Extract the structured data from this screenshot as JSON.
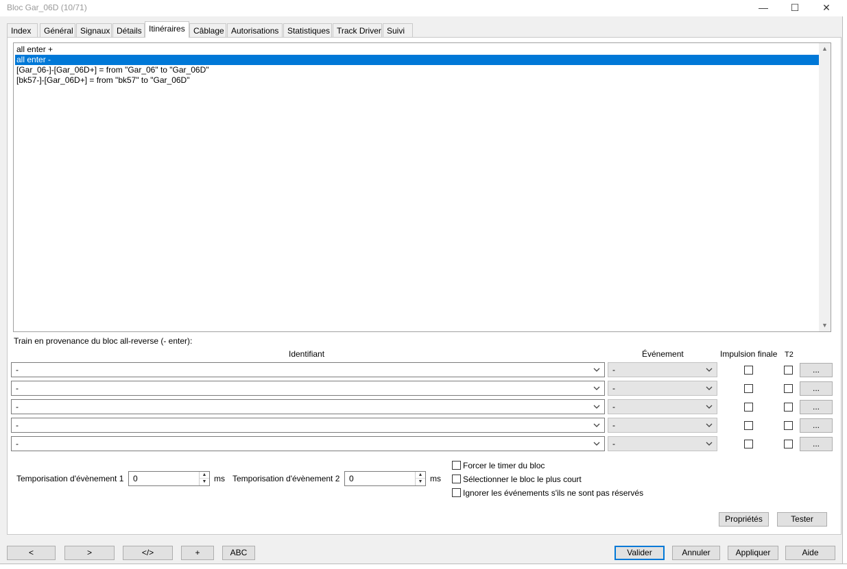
{
  "window": {
    "title": "Bloc Gar_06D (10/71)",
    "minimize": "—",
    "maximize": "☐",
    "close": "✕"
  },
  "tabs": [
    "Index",
    "Général",
    "Signaux",
    "Détails",
    "Itinéraires",
    "Câblage",
    "Autorisations",
    "Statistiques",
    "Track Driver",
    "Suivi"
  ],
  "active_tab": "Itinéraires",
  "routes_list": [
    "all enter +",
    "all enter -",
    "[Gar_06-]-[Gar_06D+] = from \"Gar_06\" to \"Gar_06D\"",
    "[bk57-]-[Gar_06D+] = from \"bk57\" to \"Gar_06D\""
  ],
  "selected_route": "all enter -",
  "section": {
    "label": "Train en provenance du bloc all-reverse (- enter):",
    "col_identifiant": "Identifiant",
    "col_evenement": "Événement",
    "col_impulsion": "Impulsion finale",
    "col_t2": "T2"
  },
  "rows": [
    {
      "identifiant": "-",
      "evenement": "-",
      "impulsion": false,
      "t2": false,
      "more": "..."
    },
    {
      "identifiant": "-",
      "evenement": "-",
      "impulsion": false,
      "t2": false,
      "more": "..."
    },
    {
      "identifiant": "-",
      "evenement": "-",
      "impulsion": false,
      "t2": false,
      "more": "..."
    },
    {
      "identifiant": "-",
      "evenement": "-",
      "impulsion": false,
      "t2": false,
      "more": "..."
    },
    {
      "identifiant": "-",
      "evenement": "-",
      "impulsion": false,
      "t2": false,
      "more": "..."
    }
  ],
  "timers": {
    "tempo1_label": "Temporisation d'évènement 1",
    "tempo1_value": "0",
    "tempo1_unit": "ms",
    "tempo2_label": "Temporisation d'évènement 2",
    "tempo2_value": "0",
    "tempo2_unit": "ms"
  },
  "options": [
    {
      "label": "Forcer le timer du bloc",
      "checked": false
    },
    {
      "label": "Sélectionner le bloc le plus court",
      "checked": false
    },
    {
      "label": "Ignorer les événements s'ils ne sont pas réservés",
      "checked": false
    }
  ],
  "panel_buttons": {
    "proprietes": "Propriétés",
    "tester": "Tester"
  },
  "footer_left": [
    "<",
    ">",
    "</>",
    "+",
    "ABC"
  ],
  "footer_right": {
    "valider": "Valider",
    "annuler": "Annuler",
    "appliquer": "Appliquer",
    "aide": "Aide"
  },
  "colors": {
    "selection": "#0078d7",
    "window_bg": "#f0f0f0",
    "panel_bg": "#ffffff"
  }
}
